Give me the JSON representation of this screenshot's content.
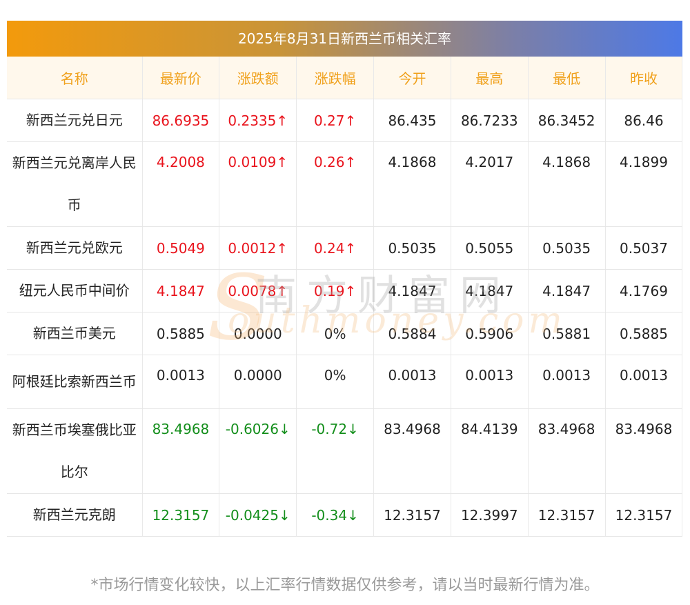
{
  "title": "2025年8月31日新西兰币相关汇率",
  "headers": [
    "名称",
    "最新价",
    "涨跌额",
    "涨跌幅",
    "今开",
    "最高",
    "最低",
    "昨收"
  ],
  "rows": [
    {
      "name": "新西兰元兑日元",
      "latest": "86.6935",
      "change": "0.2335↑",
      "pct": "0.27↑",
      "open": "86.435",
      "high": "86.7233",
      "low": "86.3452",
      "prev": "86.46",
      "trend": "up"
    },
    {
      "name": "新西兰元兑离岸人民币",
      "latest": "4.2008",
      "change": "0.0109↑",
      "pct": "0.26↑",
      "open": "4.1868",
      "high": "4.2017",
      "low": "4.1868",
      "prev": "4.1899",
      "trend": "up"
    },
    {
      "name": "新西兰元兑欧元",
      "latest": "0.5049",
      "change": "0.0012↑",
      "pct": "0.24↑",
      "open": "0.5035",
      "high": "0.5055",
      "low": "0.5035",
      "prev": "0.5037",
      "trend": "up"
    },
    {
      "name": "纽元人民币中间价",
      "latest": "4.1847",
      "change": "0.0078↑",
      "pct": "0.19↑",
      "open": "4.1847",
      "high": "4.1847",
      "low": "4.1847",
      "prev": "4.1769",
      "trend": "up"
    },
    {
      "name": "新西兰币美元",
      "latest": "0.5885",
      "change": "0.0000",
      "pct": "0%",
      "open": "0.5884",
      "high": "0.5906",
      "low": "0.5881",
      "prev": "0.5885",
      "trend": "flat"
    },
    {
      "name": "阿根廷比索新西兰币",
      "latest": "0.0013",
      "change": "0.0000",
      "pct": "0%",
      "open": "0.0013",
      "high": "0.0013",
      "low": "0.0013",
      "prev": "0.0013",
      "trend": "flat"
    },
    {
      "name": "新西兰币埃塞俄比亚比尔",
      "latest": "83.4968",
      "change": "-0.6026↓",
      "pct": "-0.72↓",
      "open": "83.4968",
      "high": "84.4139",
      "low": "83.4968",
      "prev": "83.4968",
      "trend": "down"
    },
    {
      "name": "新西兰元克朗",
      "latest": "12.3157",
      "change": "-0.0425↓",
      "pct": "-0.34↓",
      "open": "12.3157",
      "high": "12.3997",
      "low": "12.3157",
      "prev": "12.3157",
      "trend": "down"
    }
  ],
  "footnote": "*市场行情变化较快，以上汇率行情数据仅供参考，请以当时最新行情为准。",
  "watermark": {
    "cn": "南方财富网",
    "en": "outhmoney.com",
    "initial": "S"
  },
  "colors": {
    "up": "#e9141d",
    "down": "#138e1b",
    "header_text": "#f0a11c",
    "header_bg": "#fff8ec"
  }
}
